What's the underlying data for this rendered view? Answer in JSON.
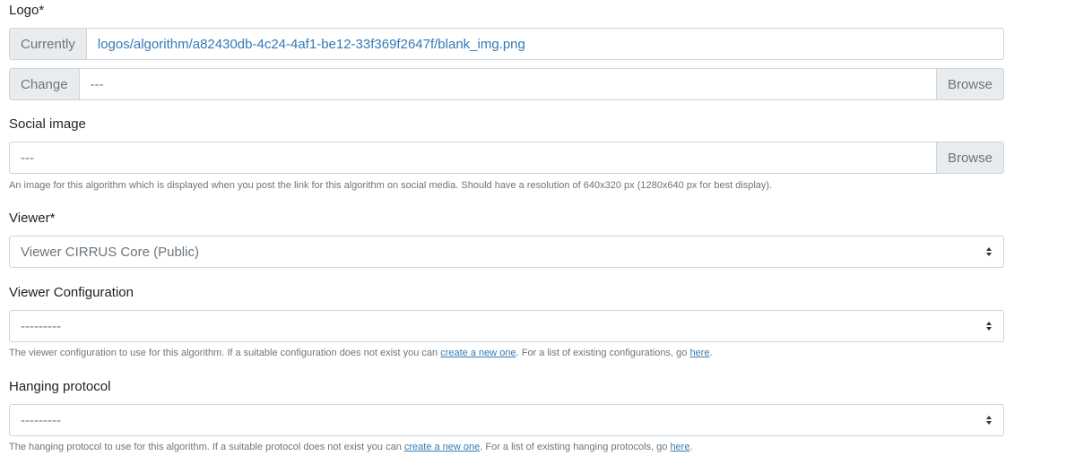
{
  "logo": {
    "label": "Logo*",
    "currently_label": "Currently",
    "current_file": "logos/algorithm/a82430db-4c24-4af1-be12-33f369f2647f/blank_img.png",
    "change_label": "Change",
    "change_value": "---",
    "browse_label": "Browse"
  },
  "social_image": {
    "label": "Social image",
    "value": "---",
    "browse_label": "Browse",
    "help": "An image for this algorithm which is displayed when you post the link for this algorithm on social media. Should have a resolution of 640x320 px (1280x640 px for best display)."
  },
  "viewer": {
    "label": "Viewer*",
    "selected": "Viewer CIRRUS Core (Public)"
  },
  "viewer_configuration": {
    "label": "Viewer Configuration",
    "selected": "---------",
    "help_prefix": "The viewer configuration to use for this algorithm. If a suitable configuration does not exist you can ",
    "help_link_create": "create a new one",
    "help_middle": ". For a list of existing configurations, go ",
    "help_link_here": "here",
    "help_suffix": "."
  },
  "hanging_protocol": {
    "label": "Hanging protocol",
    "selected": "---------",
    "help_prefix": "The hanging protocol to use for this algorithm. If a suitable protocol does not exist you can ",
    "help_link_create": "create a new one",
    "help_middle": ". For a list of existing hanging protocols, go ",
    "help_link_here": "here",
    "help_suffix": "."
  }
}
